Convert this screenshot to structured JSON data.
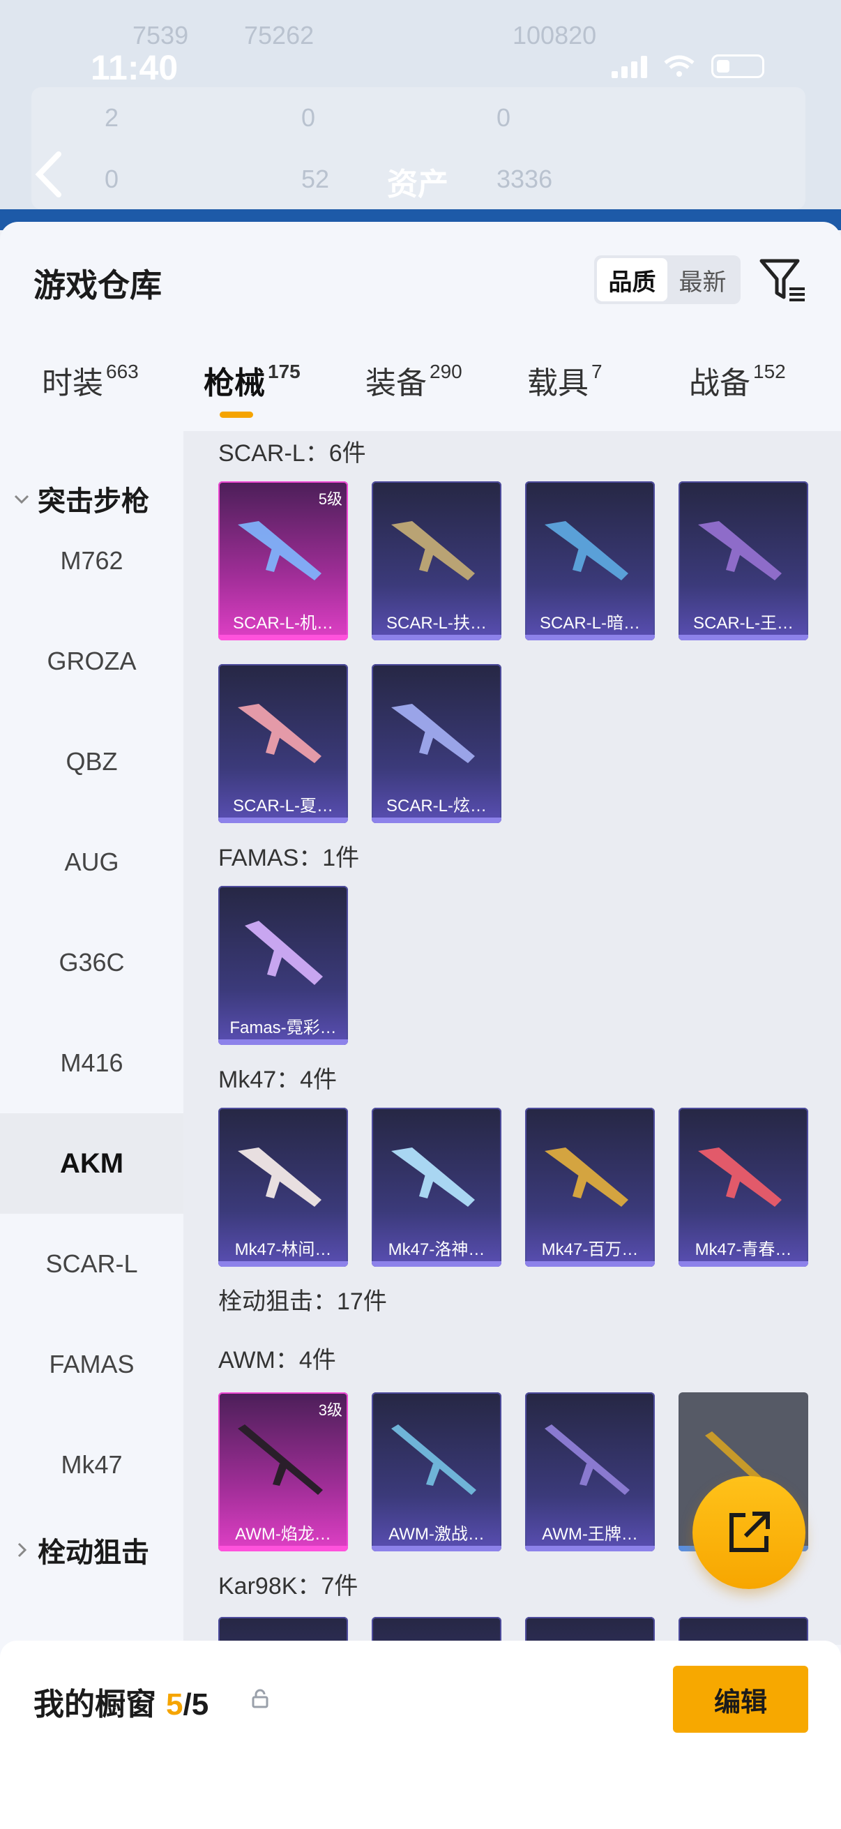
{
  "status_bar": {
    "time": "11:40"
  },
  "background_header": {
    "title": "资产",
    "stats_row1": [
      "7539",
      "75262",
      "100820"
    ],
    "stats_row2": [
      "2",
      "0",
      "0"
    ],
    "stats_row3": [
      "0",
      "52",
      "3336"
    ]
  },
  "sheet": {
    "title": "游戏仓库",
    "sort": {
      "options": [
        "品质",
        "最新"
      ],
      "selected": "品质"
    }
  },
  "tabs": [
    {
      "label": "时装",
      "count": "663"
    },
    {
      "label": "枪械",
      "count": "175",
      "active": true
    },
    {
      "label": "装备",
      "count": "290"
    },
    {
      "label": "载具",
      "count": "7"
    },
    {
      "label": "战备",
      "count": "152"
    }
  ],
  "sidebar": {
    "group1": "突击步枪",
    "items": [
      "M762",
      "GROZA",
      "QBZ",
      "AUG",
      "G36C",
      "M416",
      "AKM",
      "SCAR-L",
      "FAMAS",
      "Mk47"
    ],
    "active": "AKM",
    "group2": "栓动狙击"
  },
  "sections": [
    {
      "label": "SCAR-L：6件",
      "items": [
        {
          "name": "SCAR-L-机…",
          "level": "5级",
          "rarity": "pink"
        },
        {
          "name": "SCAR-L-扶…"
        },
        {
          "name": "SCAR-L-暗…"
        },
        {
          "name": "SCAR-L-王…"
        },
        {
          "name": "SCAR-L-夏…"
        },
        {
          "name": "SCAR-L-炫…"
        }
      ]
    },
    {
      "label": "FAMAS：1件",
      "items": [
        {
          "name": "Famas-霓彩…"
        }
      ]
    },
    {
      "label": "Mk47：4件",
      "items": [
        {
          "name": "Mk47-林间…"
        },
        {
          "name": "Mk47-洛神…"
        },
        {
          "name": "Mk47-百万…"
        },
        {
          "name": "Mk47-青春…"
        }
      ]
    },
    {
      "label": "栓动狙击：17件"
    },
    {
      "label": "AWM：4件",
      "items": [
        {
          "name": "AWM-焰龙…",
          "level": "3级",
          "rarity": "pink"
        },
        {
          "name": "AWM-激战…"
        },
        {
          "name": "AWM-王牌…"
        },
        {
          "name": ""
        }
      ]
    },
    {
      "label": "Kar98K：7件"
    }
  ],
  "bottom_bar": {
    "title": "我的橱窗",
    "count_current": "5",
    "count_total": "/5",
    "edit_label": "编辑"
  }
}
